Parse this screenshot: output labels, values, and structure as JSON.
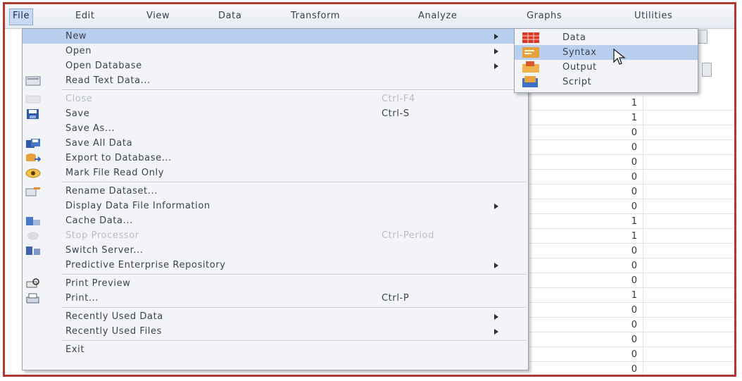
{
  "menubar": {
    "items": [
      "File",
      "Edit",
      "View",
      "Data",
      "Transform",
      "Analyze",
      "Graphs",
      "Utilities"
    ]
  },
  "file_menu": {
    "items": [
      {
        "label": "New",
        "shortcut": "",
        "submenu": true,
        "icon": "none",
        "disabled": false,
        "highlighted": true
      },
      {
        "label": "Open",
        "shortcut": "",
        "submenu": true,
        "icon": "none",
        "disabled": false
      },
      {
        "label": "Open Database",
        "shortcut": "",
        "submenu": true,
        "icon": "none",
        "disabled": false
      },
      {
        "label": "Read Text Data...",
        "shortcut": "",
        "submenu": false,
        "icon": "text-data-icon",
        "disabled": false
      },
      {
        "label": "Close",
        "shortcut": "Ctrl-F4",
        "submenu": false,
        "icon": "close-window-icon",
        "disabled": true
      },
      {
        "label": "Save",
        "shortcut": "Ctrl-S",
        "submenu": false,
        "icon": "floppy-disk-icon",
        "disabled": false
      },
      {
        "label": "Save As...",
        "shortcut": "",
        "submenu": false,
        "icon": "none",
        "disabled": false
      },
      {
        "label": "Save All Data",
        "shortcut": "",
        "submenu": false,
        "icon": "save-all-icon",
        "disabled": false
      },
      {
        "label": "Export to Database...",
        "shortcut": "",
        "submenu": false,
        "icon": "export-database-icon",
        "disabled": false
      },
      {
        "label": "Mark File Read Only",
        "shortcut": "",
        "submenu": false,
        "icon": "read-only-icon",
        "disabled": false
      },
      {
        "label": "Rename Dataset...",
        "shortcut": "",
        "submenu": false,
        "icon": "rename-dataset-icon",
        "disabled": false
      },
      {
        "label": "Display Data File Information",
        "shortcut": "",
        "submenu": true,
        "icon": "none",
        "disabled": false
      },
      {
        "label": "Cache Data...",
        "shortcut": "",
        "submenu": false,
        "icon": "cache-data-icon",
        "disabled": false
      },
      {
        "label": "Stop Processor",
        "shortcut": "Ctrl-Period",
        "submenu": false,
        "icon": "stop-processor-icon",
        "disabled": true
      },
      {
        "label": "Switch Server...",
        "shortcut": "",
        "submenu": false,
        "icon": "switch-server-icon",
        "disabled": false
      },
      {
        "label": "Predictive Enterprise Repository",
        "shortcut": "",
        "submenu": true,
        "icon": "none",
        "disabled": false
      },
      {
        "label": "Print Preview",
        "shortcut": "",
        "submenu": false,
        "icon": "print-preview-icon",
        "disabled": false
      },
      {
        "label": "Print...",
        "shortcut": "Ctrl-P",
        "submenu": false,
        "icon": "printer-icon",
        "disabled": false
      },
      {
        "label": "Recently Used Data",
        "shortcut": "",
        "submenu": true,
        "icon": "none",
        "disabled": false
      },
      {
        "label": "Recently Used Files",
        "shortcut": "",
        "submenu": true,
        "icon": "none",
        "disabled": false
      },
      {
        "label": "Exit",
        "shortcut": "",
        "submenu": false,
        "icon": "none",
        "disabled": false
      }
    ]
  },
  "new_submenu": {
    "items": [
      {
        "label": "Data",
        "icon": "data-editor-icon"
      },
      {
        "label": "Syntax",
        "icon": "syntax-editor-icon",
        "highlighted": true
      },
      {
        "label": "Output",
        "icon": "output-viewer-icon"
      },
      {
        "label": "Script",
        "icon": "script-editor-icon"
      }
    ]
  },
  "grid": {
    "values": [
      "1",
      "1",
      "0",
      "0",
      "0",
      "0",
      "0",
      "0",
      "1",
      "1",
      "0",
      "0",
      "0",
      "1",
      "0",
      "0",
      "0",
      "0",
      "0",
      "0"
    ]
  },
  "colors": {
    "frame_border": "#b03a32",
    "highlight": "#b9cff0",
    "menu_bg": "#f3f4f7"
  }
}
